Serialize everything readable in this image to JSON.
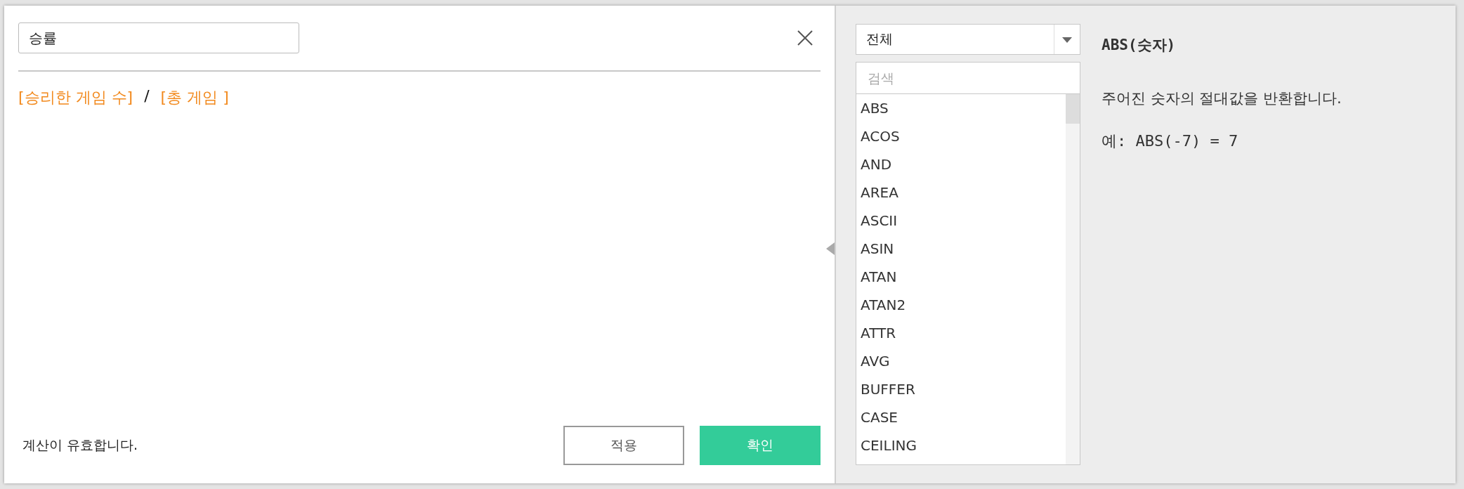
{
  "calculation": {
    "name": "승률",
    "formula": [
      {
        "kind": "field",
        "text": "[승리한 게임 수]"
      },
      {
        "kind": "operator",
        "text": "/"
      },
      {
        "kind": "field",
        "text": "[총 게임 ]"
      }
    ],
    "status": "계산이 유효합니다.",
    "buttons": [
      {
        "label": "적용",
        "kind": "secondary"
      },
      {
        "label": "확인",
        "kind": "primary"
      }
    ]
  },
  "functions": {
    "category": "전체",
    "search": {
      "placeholder": "검색"
    },
    "items": [
      "ABS",
      "ACOS",
      "AND",
      "AREA",
      "ASCII",
      "ASIN",
      "ATAN",
      "ATAN2",
      "ATTR",
      "AVG",
      "BUFFER",
      "CASE",
      "CEILING"
    ]
  },
  "help": {
    "title": "ABS(숫자)",
    "description": "주어진 숫자의 절대값을 반환합니다.",
    "example": "예: ABS(-7) = 7"
  }
}
